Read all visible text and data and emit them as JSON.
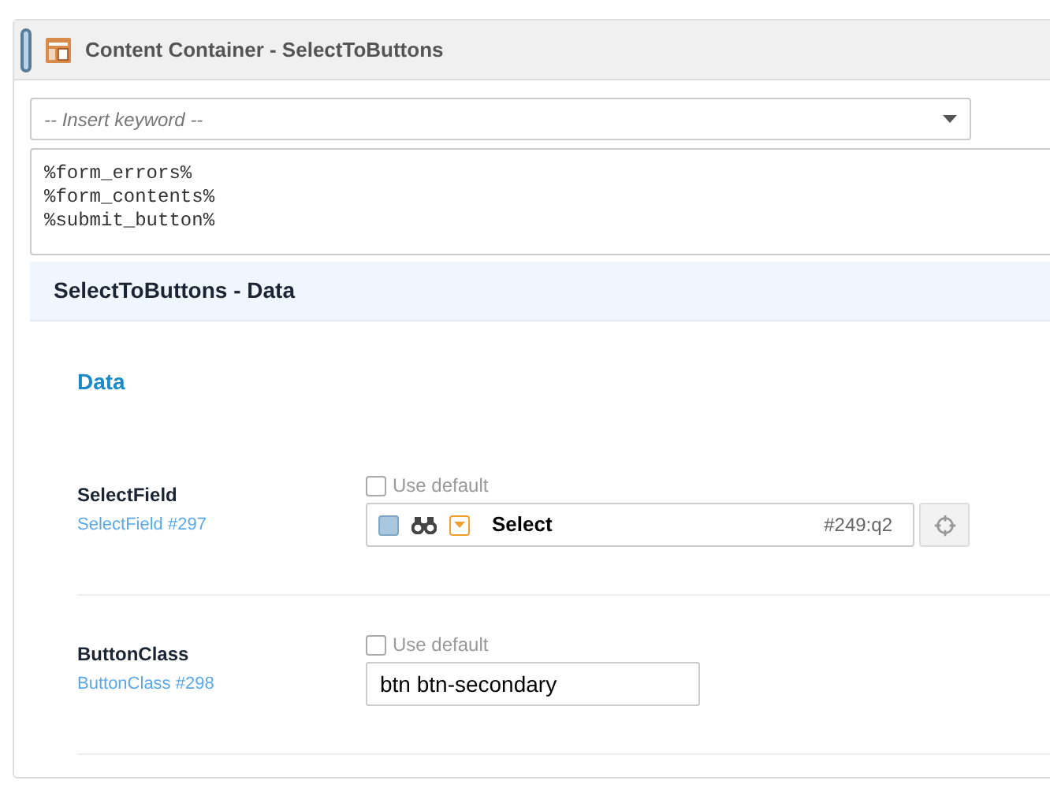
{
  "panel": {
    "title": "Content Container - SelectToButtons"
  },
  "keyword_select": {
    "placeholder": "-- Insert keyword --"
  },
  "template_lines": [
    "%form_errors%",
    "%form_contents%",
    "%submit_button%"
  ],
  "section": {
    "title": "SelectToButtons - Data",
    "group": "Data"
  },
  "fields": [
    {
      "kind": "select",
      "label": "SelectField",
      "ref": "SelectField #297",
      "use_default": {
        "label": "Use default",
        "checked": false
      },
      "value": "Select",
      "id": "#249:q2"
    },
    {
      "kind": "text",
      "label": "ButtonClass",
      "ref": "ButtonClass #298",
      "use_default": {
        "label": "Use default",
        "checked": false
      },
      "value": "btn btn-secondary"
    }
  ]
}
